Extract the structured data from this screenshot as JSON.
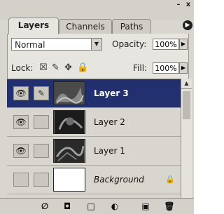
{
  "window": {
    "minimize": "–",
    "close": "x"
  },
  "tabs": [
    {
      "label": "Layers",
      "active": true
    },
    {
      "label": "Channels",
      "active": false
    },
    {
      "label": "Paths",
      "active": false
    }
  ],
  "blend_mode": "Normal",
  "opacity": {
    "label": "Opacity:",
    "value": "100%"
  },
  "lock": {
    "label": "Lock:"
  },
  "fill": {
    "label": "Fill:",
    "value": "100%"
  },
  "layers": [
    {
      "name": "Layer 3",
      "selected": true,
      "visible": true,
      "linked_brush": true
    },
    {
      "name": "Layer 2",
      "selected": false,
      "visible": true,
      "linked_brush": false
    },
    {
      "name": "Layer 1",
      "selected": false,
      "visible": true,
      "linked_brush": false
    },
    {
      "name": "Background",
      "selected": false,
      "visible": false,
      "linked_brush": false,
      "locked": true
    }
  ],
  "colors": {
    "selection": "#23306f",
    "panel": "#d8d6cf"
  }
}
